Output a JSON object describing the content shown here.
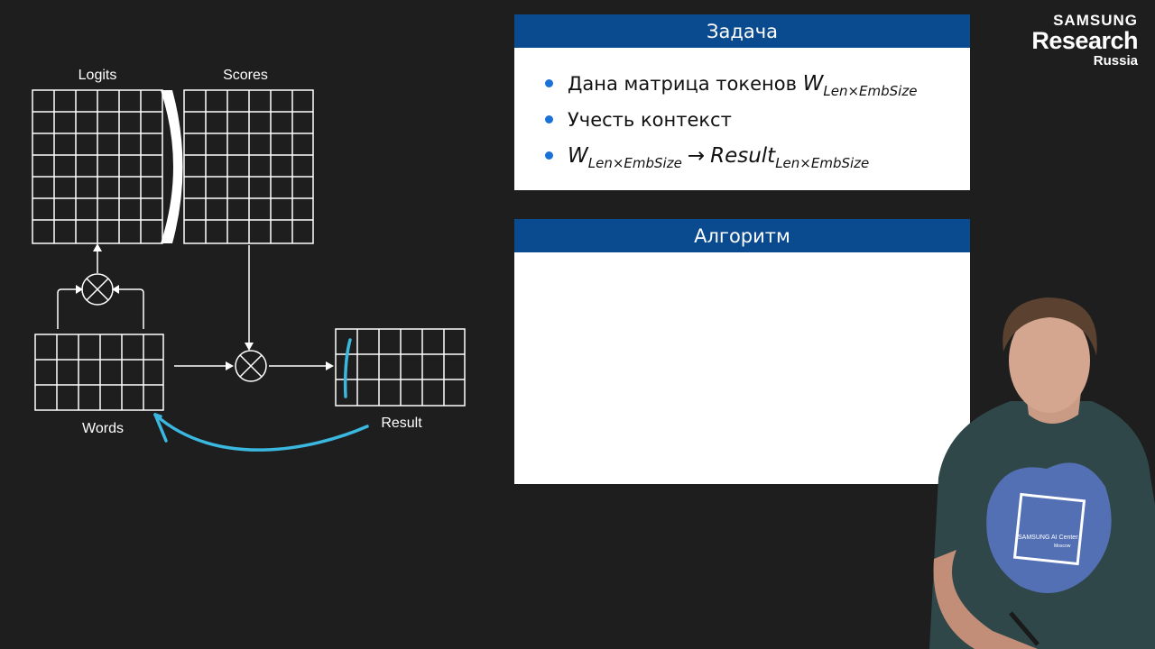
{
  "diagram": {
    "labels": {
      "logits": "Logits",
      "scores": "Scores",
      "words": "Words",
      "result": "Result"
    },
    "colors": {
      "annotation": "#3ab8e0",
      "lines": "#ffffff"
    }
  },
  "task_panel": {
    "title": "Задача",
    "bullets": [
      {
        "text": "Дана матрица токенов",
        "math_base": "W",
        "math_sub": "Len×EmbSize"
      },
      {
        "text": "Учесть контекст"
      },
      {
        "lhs_base": "W",
        "lhs_sub": "Len×EmbSize",
        "arrow": "→",
        "rhs_base": "Result",
        "rhs_sub": "Len×EmbSize"
      }
    ]
  },
  "algo_panel": {
    "title": "Алгоритм"
  },
  "brand": {
    "line1": "SAMSUNG",
    "line2": "Research",
    "line3": "Russia"
  },
  "presenter": {
    "shirt_line1": "SAMSUNG AI Center",
    "shirt_line2": "Moscow"
  }
}
